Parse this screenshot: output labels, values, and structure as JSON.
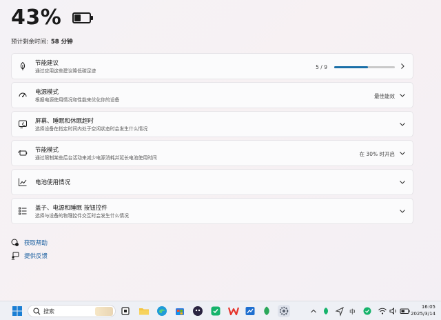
{
  "battery": {
    "percent_label": "43%",
    "level": 0.43,
    "remaining_label": "预计剩余时间:",
    "remaining_value": "58 分钟"
  },
  "cards": [
    {
      "id": "energy-recommendations",
      "icon": "leaf-icon",
      "title": "节能建议",
      "subtitle": "通过应用这些建议降低碳足迹",
      "progress_text": "5 / 9",
      "progress_value": 0.5556
    },
    {
      "id": "power-mode",
      "icon": "power-mode-icon",
      "title": "电源模式",
      "subtitle": "根据电源使用情况和性能来优化你的设备",
      "value": "最佳能效"
    },
    {
      "id": "screen-sleep",
      "icon": "screen-sleep-icon",
      "title": "屏幕、睡眠和休眠超时",
      "subtitle": "选择设备在指定时间内处于空闲状态时会发生什么情况",
      "value": ""
    },
    {
      "id": "energy-saver",
      "icon": "battery-saver-icon",
      "title": "节能模式",
      "subtitle": "通过限制某些后台活动来减少电源消耗并延长电池使用时间",
      "value": "在 30% 时开启"
    },
    {
      "id": "battery-usage",
      "icon": "chart-line-icon",
      "title": "电池使用情况",
      "subtitle": "",
      "value": ""
    },
    {
      "id": "lid-power-buttons",
      "icon": "list-settings-icon",
      "title": "盖子、电源和睡眠 按钮控件",
      "subtitle": "选择与设备的物理控件交互时会发生什么情况",
      "value": ""
    }
  ],
  "links": {
    "help": "获取帮助",
    "feedback": "提供反馈"
  },
  "taskbar": {
    "search_placeholder": "搜索",
    "ime": "中",
    "time": "16:05",
    "date": "2025/3/14"
  },
  "colors": {
    "accent": "#1a6fa8",
    "link": "#1a5fa0"
  }
}
